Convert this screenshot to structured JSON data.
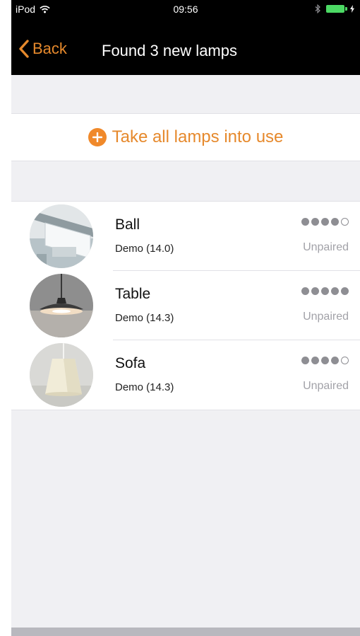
{
  "statusbar": {
    "carrier": "iPod",
    "time": "09:56"
  },
  "navbar": {
    "back_label": "Back",
    "title": "Found 3 new lamps"
  },
  "action": {
    "take_all_label": "Take all lamps into use"
  },
  "lamps": [
    {
      "name": "Ball",
      "subtitle": "Demo (14.0)",
      "signal": 4,
      "signal_max": 5,
      "status": "Unpaired"
    },
    {
      "name": "Table",
      "subtitle": "Demo (14.3)",
      "signal": 5,
      "signal_max": 5,
      "status": "Unpaired"
    },
    {
      "name": "Sofa",
      "subtitle": "Demo (14.3)",
      "signal": 4,
      "signal_max": 5,
      "status": "Unpaired"
    }
  ],
  "colors": {
    "accent": "#e6892c",
    "navbar_bg": "#000000",
    "page_bg": "#f0f0f3",
    "signal_dot": "#8e8e93"
  },
  "icons": [
    "wifi-icon",
    "bluetooth-icon",
    "battery-icon",
    "back-chevron-icon",
    "plus-circle-icon",
    "signal-dot-icon"
  ]
}
